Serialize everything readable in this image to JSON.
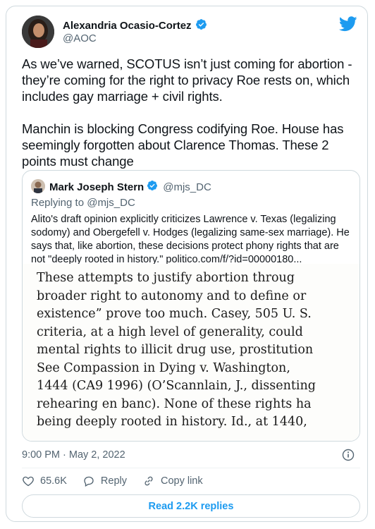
{
  "author": {
    "name": "Alexandria Ocasio-Cortez",
    "handle": "@AOC",
    "verified": true
  },
  "tweet": {
    "text": "As we’ve warned, SCOTUS isn’t just coming for abortion - they’re coming for the right to privacy Roe rests on, which includes gay marriage + civil rights.\n\nManchin is blocking Congress codifying Roe. House has seemingly forgotten about Clarence Thomas. These 2 points must change",
    "timestamp": "9:00 PM · May 2, 2022"
  },
  "quote": {
    "name": "Mark Joseph Stern",
    "handle": "@mjs_DC",
    "reply_to": "Replying to @mjs_DC",
    "text": "Alito's draft opinion explicitly criticizes Lawrence v. Texas (legalizing sodomy) and Obergefell v. Hodges (legalizing same-sex marriage). He says that, like abortion, these decisions protect phony rights that are not \"deeply rooted in history.\" politico.com/f/?id=00000180...",
    "image_lines": [
      "These attempts to justify abortion throug",
      "broader right to autonomy and to define or",
      "existence” prove too much. Casey, 505 U. S.",
      "criteria, at a high level of generality, could",
      "mental rights to illicit drug use, prostitution",
      "See Compassion in Dying v. Washington,",
      "1444 (CA9 1996) (O’Scannlain, J., dissenting",
      "rehearing en banc). None of these rights ha",
      "being deeply rooted in history. Id., at 1440,"
    ]
  },
  "actions": {
    "likes": "65.6K",
    "reply_label": "Reply",
    "copy_link_label": "Copy link"
  },
  "read_replies_label": "Read 2.2K replies",
  "colors": {
    "accent": "#1d9bf0",
    "secondary_text": "#536471",
    "border": "#cfd9de"
  }
}
